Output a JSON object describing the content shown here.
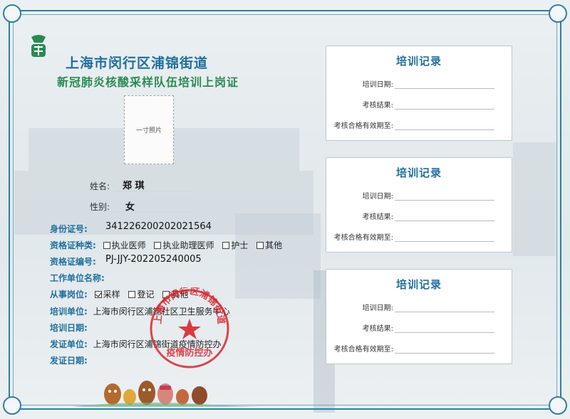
{
  "header": {
    "title_line1": "上海市闵行区浦锦街道",
    "title_line2": "新冠肺炎核酸采样队伍培训上岗证"
  },
  "photo": {
    "placeholder": "一寸照片"
  },
  "person": {
    "name_label": "姓名:",
    "name_value": "郑 琪",
    "gender_label": "性别:",
    "gender_value": "女",
    "id_label": "身份证号:",
    "id_value": "341226200202021564",
    "cert_type_label": "资格证种类:",
    "cert_types": [
      {
        "label": "执业医师",
        "checked": false
      },
      {
        "label": "执业助理医师",
        "checked": false
      },
      {
        "label": "护士",
        "checked": false
      },
      {
        "label": "其他",
        "checked": false
      }
    ],
    "cert_no_label": "资格证编号:",
    "cert_no_value": "PJ-JJY-202205240005",
    "work_unit_label": "工作单位名称:",
    "post_label": "从事岗位:",
    "posts": [
      {
        "label": "采样",
        "checked": true
      },
      {
        "label": "登记",
        "checked": false
      },
      {
        "label": "其他",
        "checked": false
      }
    ],
    "training_unit_label": "培训单位:",
    "training_unit_value": "上海市闵行区浦锦社区卫生服务中心",
    "training_date_label": "培训日期:",
    "issuer_label": "发证单位:",
    "issuer_value": "上海市闵行区浦锦街道疫情防控办",
    "issue_date_label": "发证日期:"
  },
  "stamp": {
    "arc_text": "上海市闵行区浦锦街道",
    "bottom_text": "疫情防控办"
  },
  "records": [
    {
      "title": "培训记录",
      "date_label": "培训日期:",
      "result_label": "考核结果:",
      "valid_label": "考核合格有效期至:"
    },
    {
      "title": "培训记录",
      "date_label": "培训日期:",
      "result_label": "考核结果:",
      "valid_label": "考核合格有效期至:"
    },
    {
      "title": "培训记录",
      "date_label": "培训日期:",
      "result_label": "考核结果:",
      "valid_label": "考核合格有效期至:"
    }
  ],
  "colors": {
    "frame": "#2f7fa3",
    "title_blue": "#1f6fa0",
    "title_green": "#2a8a54",
    "stamp_red": "#d9262c"
  }
}
